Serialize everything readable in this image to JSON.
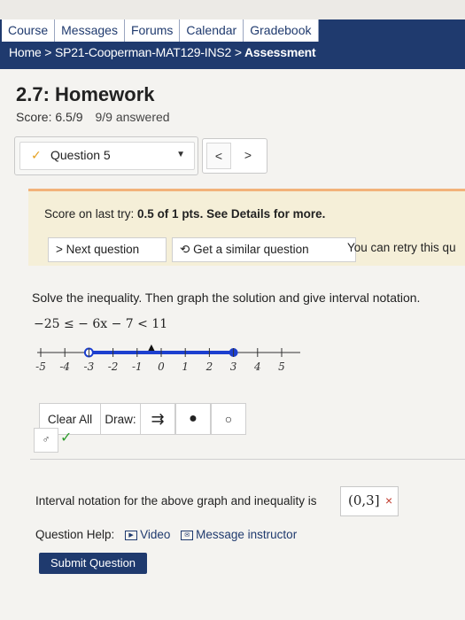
{
  "nav": {
    "tabs": [
      "Course",
      "Messages",
      "Forums",
      "Calendar",
      "Gradebook"
    ],
    "breadcrumb": [
      "Home",
      ">",
      "SP21-Cooperman-MAT129-INS2",
      ">",
      "Assessment"
    ]
  },
  "assessment": {
    "title": "2.7: Homework",
    "score": "Score: 6.5/9",
    "answered": "9/9 answered"
  },
  "question_select": {
    "selected": "Question 5",
    "prev": "<",
    "next": ">"
  },
  "feedback": {
    "score_prefix": "Score on last try: ",
    "score_value": "0.5 of 1 pts.",
    "score_suffix": " See Details for more.",
    "next_button": "> Next question",
    "similar_button": "Get a similar question",
    "retry_text": "You can retry this qu"
  },
  "problem": {
    "instruction": "Solve the inequality. Then graph the solution and give interval notation.",
    "inequality": "−25 ≤ − 6x − 7 < 11"
  },
  "number_line": {
    "ticks": [
      "-5",
      "-4",
      "-3",
      "-2",
      "-1",
      "0",
      "1",
      "2",
      "3",
      "4",
      "5"
    ],
    "segment_start": -3,
    "segment_end": 3,
    "start_closed": false,
    "end_closed": true
  },
  "graph_tools": {
    "clear": "Clear All",
    "draw": "Draw:"
  },
  "interval": {
    "label": "Interval notation for the above graph and inequality is",
    "answer": "(0,3]",
    "mark": "×"
  },
  "help": {
    "label": "Question Help:",
    "video": "Video",
    "message": "Message instructor"
  },
  "submit": "Submit Question",
  "colors": {
    "nav": "#1f3a6e",
    "segment": "#1c3fcf",
    "feedback_bg": "#f5efd8",
    "feedback_border": "#f2b27a",
    "wrong": "#c0392b",
    "correct": "#2e9c2e"
  }
}
